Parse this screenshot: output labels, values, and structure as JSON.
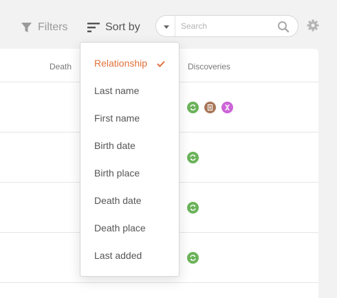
{
  "toolbar": {
    "filters_label": "Filters",
    "sort_label": "Sort by",
    "search_placeholder": "Search",
    "search_value": ""
  },
  "table": {
    "columns": [
      "Death",
      "Discoveries"
    ],
    "rows": [
      {
        "discoveries": [
          "record-match-icon",
          "document-icon",
          "dna-icon"
        ]
      },
      {
        "discoveries": [
          "record-match-icon"
        ]
      },
      {
        "discoveries": [
          "record-match-icon"
        ]
      },
      {
        "discoveries": [
          "record-match-icon"
        ]
      }
    ]
  },
  "sort_menu": {
    "selected": "Relationship",
    "options": [
      "Relationship",
      "Last name",
      "First name",
      "Birth date",
      "Birth place",
      "Death date",
      "Death place",
      "Last added"
    ]
  },
  "colors": {
    "accent": "#e0703a",
    "record_match": "#6bb35a",
    "document": "#a8775a",
    "dna": "#cc63d8"
  }
}
